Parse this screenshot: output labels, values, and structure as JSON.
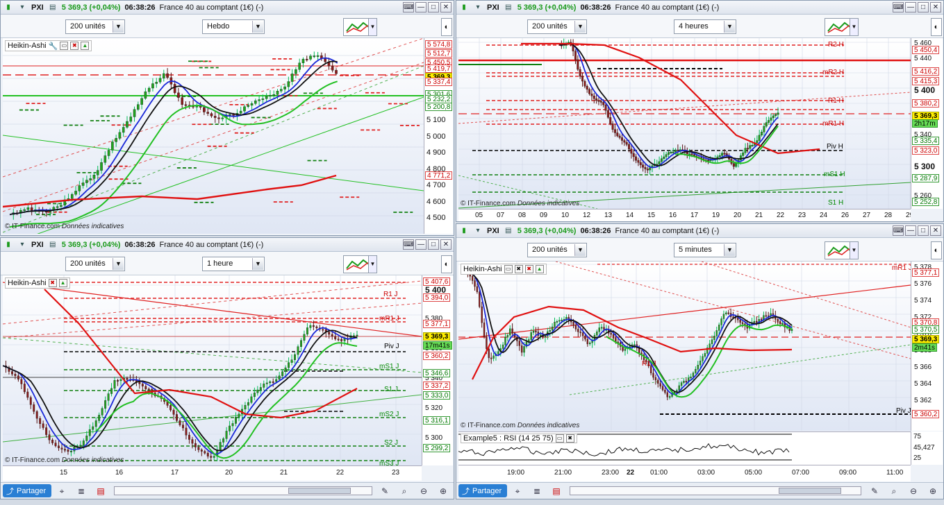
{
  "windows": {
    "w1": {
      "symbol": "PXI",
      "price": "5 369,3 (+0,04%)",
      "time": "06:38:26",
      "instrument": "France 40 au comptant (1€) (-)",
      "units": "200 unités",
      "period": "Hebdo",
      "indicator": "Heikin-Ashi",
      "credit_src": "© IT-Finance.com",
      "credit_note": "Données indicatives",
      "yticks": [
        "5 100",
        "5 000",
        "4 900",
        "4 800",
        "4 700",
        "4 600",
        "4 500"
      ],
      "ylabels": [
        {
          "t": "5 574,8",
          "c": "red"
        },
        {
          "t": "5 512,7",
          "c": "red"
        },
        {
          "t": "5 450,5",
          "c": "red"
        },
        {
          "t": "5 419,7",
          "c": "red"
        },
        {
          "t": "5 369,3",
          "c": "hl"
        },
        {
          "t": "5 337,4",
          "c": "red"
        },
        {
          "t": "5 301,6",
          "c": "green"
        },
        {
          "t": "5 232,2",
          "c": "green"
        },
        {
          "t": "5 200,8",
          "c": "green"
        },
        {
          "t": "4 771,2",
          "c": "red"
        }
      ]
    },
    "w2": {
      "symbol": "PXI",
      "price": "5 369,3 (+0,04%)",
      "time": "06:38:26",
      "instrument": "France 40 au comptant (1€) (-)",
      "units": "200 unités",
      "period": "4 heures",
      "credit_src": "© IT-Finance.com",
      "credit_note": "Données indicatives",
      "yticks": [
        "5 460",
        "5 440",
        "5 420",
        "5 400",
        "5 380",
        "5 360",
        "5 340",
        "5 320",
        "5 300",
        "5 280",
        "5 260"
      ],
      "xticks": [
        "05",
        "07",
        "08",
        "09",
        "10",
        "12",
        "13",
        "14",
        "15",
        "16",
        "17",
        "19",
        "20",
        "21",
        "22",
        "23",
        "24",
        "26",
        "27",
        "28",
        "29"
      ],
      "ylabels": [
        {
          "t": "5 450,4",
          "c": "red"
        },
        {
          "t": "5 416,2",
          "c": "red"
        },
        {
          "t": "5 415,3",
          "c": "red"
        },
        {
          "t": "5 380,2",
          "c": "red"
        },
        {
          "t": "5 369,3",
          "c": "hl"
        },
        {
          "t": "2h17m",
          "c": "gtime"
        },
        {
          "t": "5 335,4",
          "c": "green"
        },
        {
          "t": "5 323,0",
          "c": "red"
        },
        {
          "t": "5 287,9",
          "c": "green"
        },
        {
          "t": "5 252,8",
          "c": "green"
        }
      ],
      "pivots": [
        "R2 H",
        "mR2 H",
        "R1 H",
        "mR1 H",
        "Piv H",
        "mS1 H",
        "S1 H"
      ]
    },
    "w3": {
      "symbol": "PXI",
      "price": "5 369,3 (+0,04%)",
      "time": "06:38:26",
      "instrument": "France 40 au comptant (1€) (-)",
      "units": "200 unités",
      "period": "1 heure",
      "indicator": "Heikin-Ashi",
      "credit_src": "© IT-Finance.com",
      "credit_note": "Données indicatives",
      "yticks": [
        "5 400",
        "5 380",
        "5 360",
        "5 340",
        "5 320",
        "5 300"
      ],
      "xticks": [
        "15",
        "16",
        "17",
        "20",
        "21",
        "22",
        "23"
      ],
      "ylabels": [
        {
          "t": "5 407,6",
          "c": "red"
        },
        {
          "t": "5 394,0",
          "c": "red"
        },
        {
          "t": "5 377,1",
          "c": "red"
        },
        {
          "t": "5 369,3",
          "c": "hl"
        },
        {
          "t": "17m41s",
          "c": "gtime"
        },
        {
          "t": "5 360,2",
          "c": "red"
        },
        {
          "t": "5 346,6",
          "c": "green"
        },
        {
          "t": "5 337,2",
          "c": "red"
        },
        {
          "t": "5 333,0",
          "c": "green"
        },
        {
          "t": "5 316,1",
          "c": "green"
        },
        {
          "t": "5 299,2",
          "c": "green"
        }
      ],
      "pivots": [
        "R1 J",
        "mR1 J",
        "Piv J",
        "mS1 J",
        "S1 J",
        "mS2 J",
        "S2 J",
        "mS3 J"
      ]
    },
    "w4": {
      "symbol": "PXI",
      "price": "5 369,3 (+0,04%)",
      "time": "06:38:26",
      "instrument": "France 40 au comptant (1€) (-)",
      "units": "200 unités",
      "period": "5 minutes",
      "indicator": "Heikin-Ashi",
      "credit_src": "© IT-Finance.com",
      "credit_note": "Données indicatives",
      "yticks": [
        "5 378",
        "5 376",
        "5 374",
        "5 372",
        "5 370",
        "5 368",
        "5 366",
        "5 364",
        "5 362"
      ],
      "xticks": [
        "19:00",
        "21:00",
        "23:00",
        "22",
        "01:00",
        "03:00",
        "05:00",
        "07:00",
        "09:00",
        "11:00"
      ],
      "ylabels": [
        {
          "t": "5 377,1",
          "c": "red"
        },
        {
          "t": "5 370,8",
          "c": "red"
        },
        {
          "t": "5 370,5",
          "c": "green"
        },
        {
          "t": "5 369,3",
          "c": "hl"
        },
        {
          "t": "2m41s",
          "c": "gtime"
        },
        {
          "t": "5 360,2",
          "c": "red"
        }
      ],
      "pivots": [
        "mR1 J",
        "R1 J",
        "Piv J"
      ],
      "rsi": {
        "label": "Example5 : RSI (14 25 75)",
        "ticks": [
          "75",
          "45,427",
          "25"
        ]
      }
    }
  },
  "bottom": {
    "share_label": "Partager"
  },
  "colors": {
    "bull": "#1ea51e",
    "bear": "#8b1a1a",
    "ma_red": "#e01010",
    "ma_blue": "#1a28d8",
    "ma_black": "#111111",
    "ma_green": "#22c022",
    "pivot_red": "#e02020",
    "pivot_green": "#108010"
  }
}
